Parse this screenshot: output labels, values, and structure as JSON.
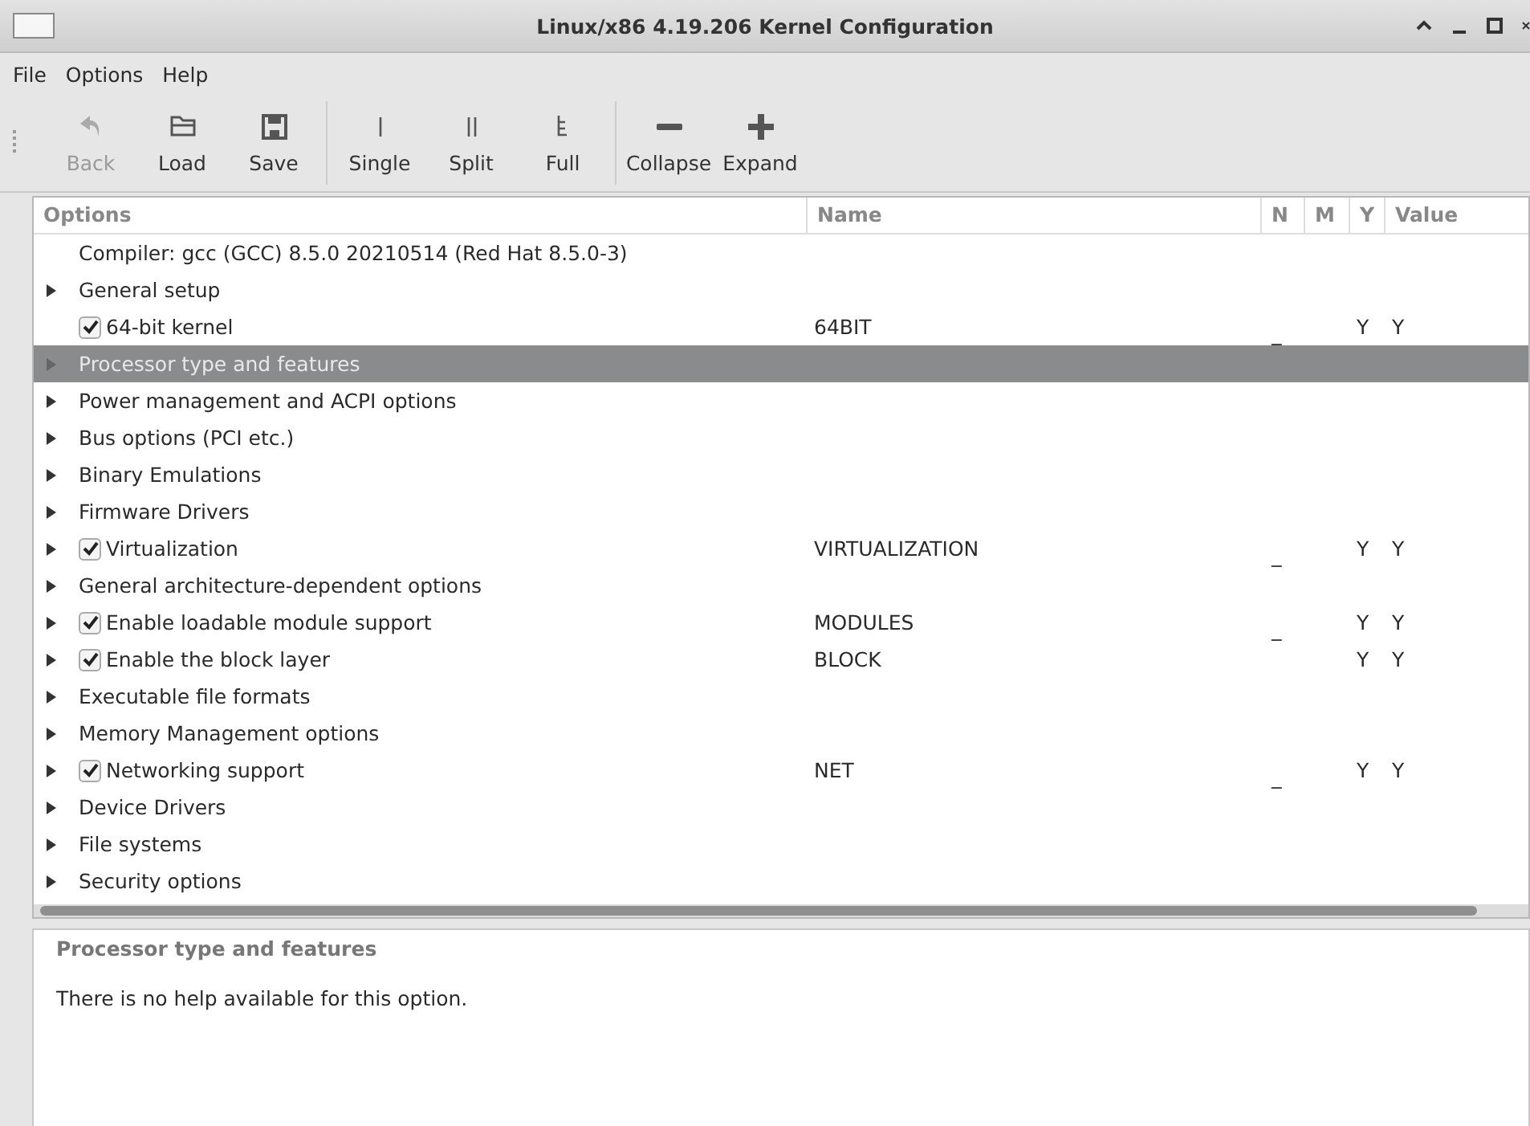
{
  "window": {
    "title": "Linux/x86 4.19.206 Kernel Configuration"
  },
  "menu": [
    "File",
    "Options",
    "Help"
  ],
  "toolbar": [
    {
      "label": "Back",
      "disabled": true
    },
    {
      "label": "Load",
      "disabled": false
    },
    {
      "label": "Save",
      "disabled": false
    },
    {
      "label": "Single",
      "disabled": false
    },
    {
      "label": "Split",
      "disabled": false
    },
    {
      "label": "Full",
      "disabled": false
    },
    {
      "label": "Collapse",
      "disabled": false
    },
    {
      "label": "Expand",
      "disabled": false
    }
  ],
  "table": {
    "columns": [
      "Options",
      "Name",
      "N",
      "M",
      "Y",
      "Value"
    ],
    "rows": [
      {
        "label": "Compiler: gcc (GCC) 8.5.0 20210514 (Red Hat 8.5.0-3)",
        "kind": "comment",
        "expandable": false,
        "selected": false
      },
      {
        "label": "General setup",
        "kind": "menu",
        "expandable": true,
        "selected": false
      },
      {
        "label": "64-bit kernel",
        "kind": "bool",
        "checked": true,
        "expandable": false,
        "selected": false,
        "name": "64BIT",
        "n": "_",
        "y": "Y",
        "value": "Y"
      },
      {
        "label": "Processor type and features",
        "kind": "menu",
        "expandable": true,
        "selected": true
      },
      {
        "label": "Power management and ACPI options",
        "kind": "menu",
        "expandable": true,
        "selected": false
      },
      {
        "label": "Bus options (PCI etc.)",
        "kind": "menu",
        "expandable": true,
        "selected": false
      },
      {
        "label": "Binary Emulations",
        "kind": "menu",
        "expandable": true,
        "selected": false
      },
      {
        "label": "Firmware Drivers",
        "kind": "menu",
        "expandable": true,
        "selected": false
      },
      {
        "label": "Virtualization",
        "kind": "bool",
        "checked": true,
        "expandable": true,
        "selected": false,
        "name": "VIRTUALIZATION",
        "n": "_",
        "y": "Y",
        "value": "Y"
      },
      {
        "label": "General architecture-dependent options",
        "kind": "menu",
        "expandable": true,
        "selected": false
      },
      {
        "label": "Enable loadable module support",
        "kind": "bool",
        "checked": true,
        "expandable": true,
        "selected": false,
        "name": "MODULES",
        "n": "_",
        "y": "Y",
        "value": "Y"
      },
      {
        "label": "Enable the block layer",
        "kind": "bool",
        "checked": true,
        "expandable": true,
        "selected": false,
        "name": "BLOCK",
        "y": "Y",
        "value": "Y"
      },
      {
        "label": "Executable file formats",
        "kind": "menu",
        "expandable": true,
        "selected": false
      },
      {
        "label": "Memory Management options",
        "kind": "menu",
        "expandable": true,
        "selected": false
      },
      {
        "label": "Networking support",
        "kind": "bool",
        "checked": true,
        "expandable": true,
        "selected": false,
        "name": "NET",
        "n": "_",
        "y": "Y",
        "value": "Y"
      },
      {
        "label": "Device Drivers",
        "kind": "menu",
        "expandable": true,
        "selected": false
      },
      {
        "label": "File systems",
        "kind": "menu",
        "expandable": true,
        "selected": false
      },
      {
        "label": "Security options",
        "kind": "menu",
        "expandable": true,
        "selected": false
      }
    ]
  },
  "help": {
    "title": "Processor type and features",
    "text": "There is no help available for this option."
  }
}
